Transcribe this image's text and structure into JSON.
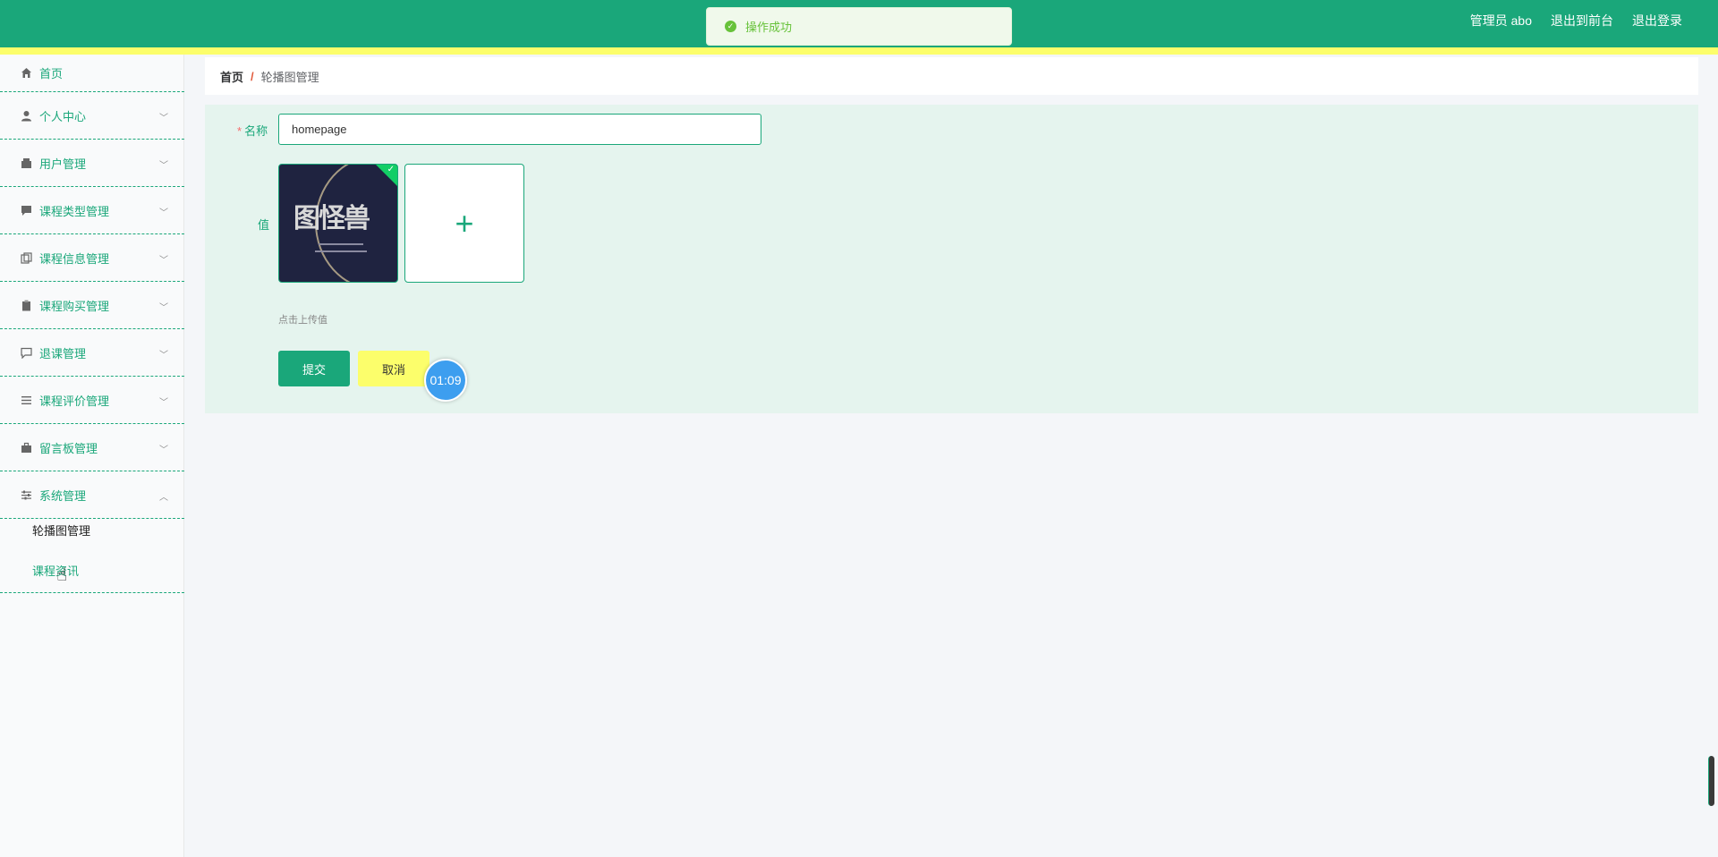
{
  "toast": {
    "message": "操作成功"
  },
  "header": {
    "user": "管理员 abo",
    "front": "退出到前台",
    "logout": "退出登录"
  },
  "sidebar": {
    "items": [
      {
        "label": "首页",
        "icon": "home-icon"
      },
      {
        "label": "个人中心",
        "icon": "user-icon"
      },
      {
        "label": "用户管理",
        "icon": "wallet-icon"
      },
      {
        "label": "课程类型管理",
        "icon": "message-icon"
      },
      {
        "label": "课程信息管理",
        "icon": "copy-icon"
      },
      {
        "label": "课程购买管理",
        "icon": "clipboard-icon"
      },
      {
        "label": "退课管理",
        "icon": "chat-icon"
      },
      {
        "label": "课程评价管理",
        "icon": "list-icon"
      },
      {
        "label": "留言板管理",
        "icon": "briefcase-icon"
      },
      {
        "label": "系统管理",
        "icon": "settings-icon"
      }
    ],
    "sub_items": [
      "轮播图管理",
      "课程资讯"
    ]
  },
  "breadcrumb": {
    "home": "首页",
    "separator": "/",
    "current": "轮播图管理"
  },
  "form": {
    "name_required_mark": "*",
    "name_label": "名称",
    "name_value": "homepage",
    "value_label": "值",
    "thumb_text": "图怪兽",
    "upload_plus": "+",
    "upload_hint": "点击上传值",
    "submit_label": "提交",
    "cancel_label": "取消"
  },
  "timer": "01:09",
  "colors": {
    "primary": "#1aa77a",
    "accent": "#fcfe6b",
    "panel": "#e5f4ee"
  }
}
